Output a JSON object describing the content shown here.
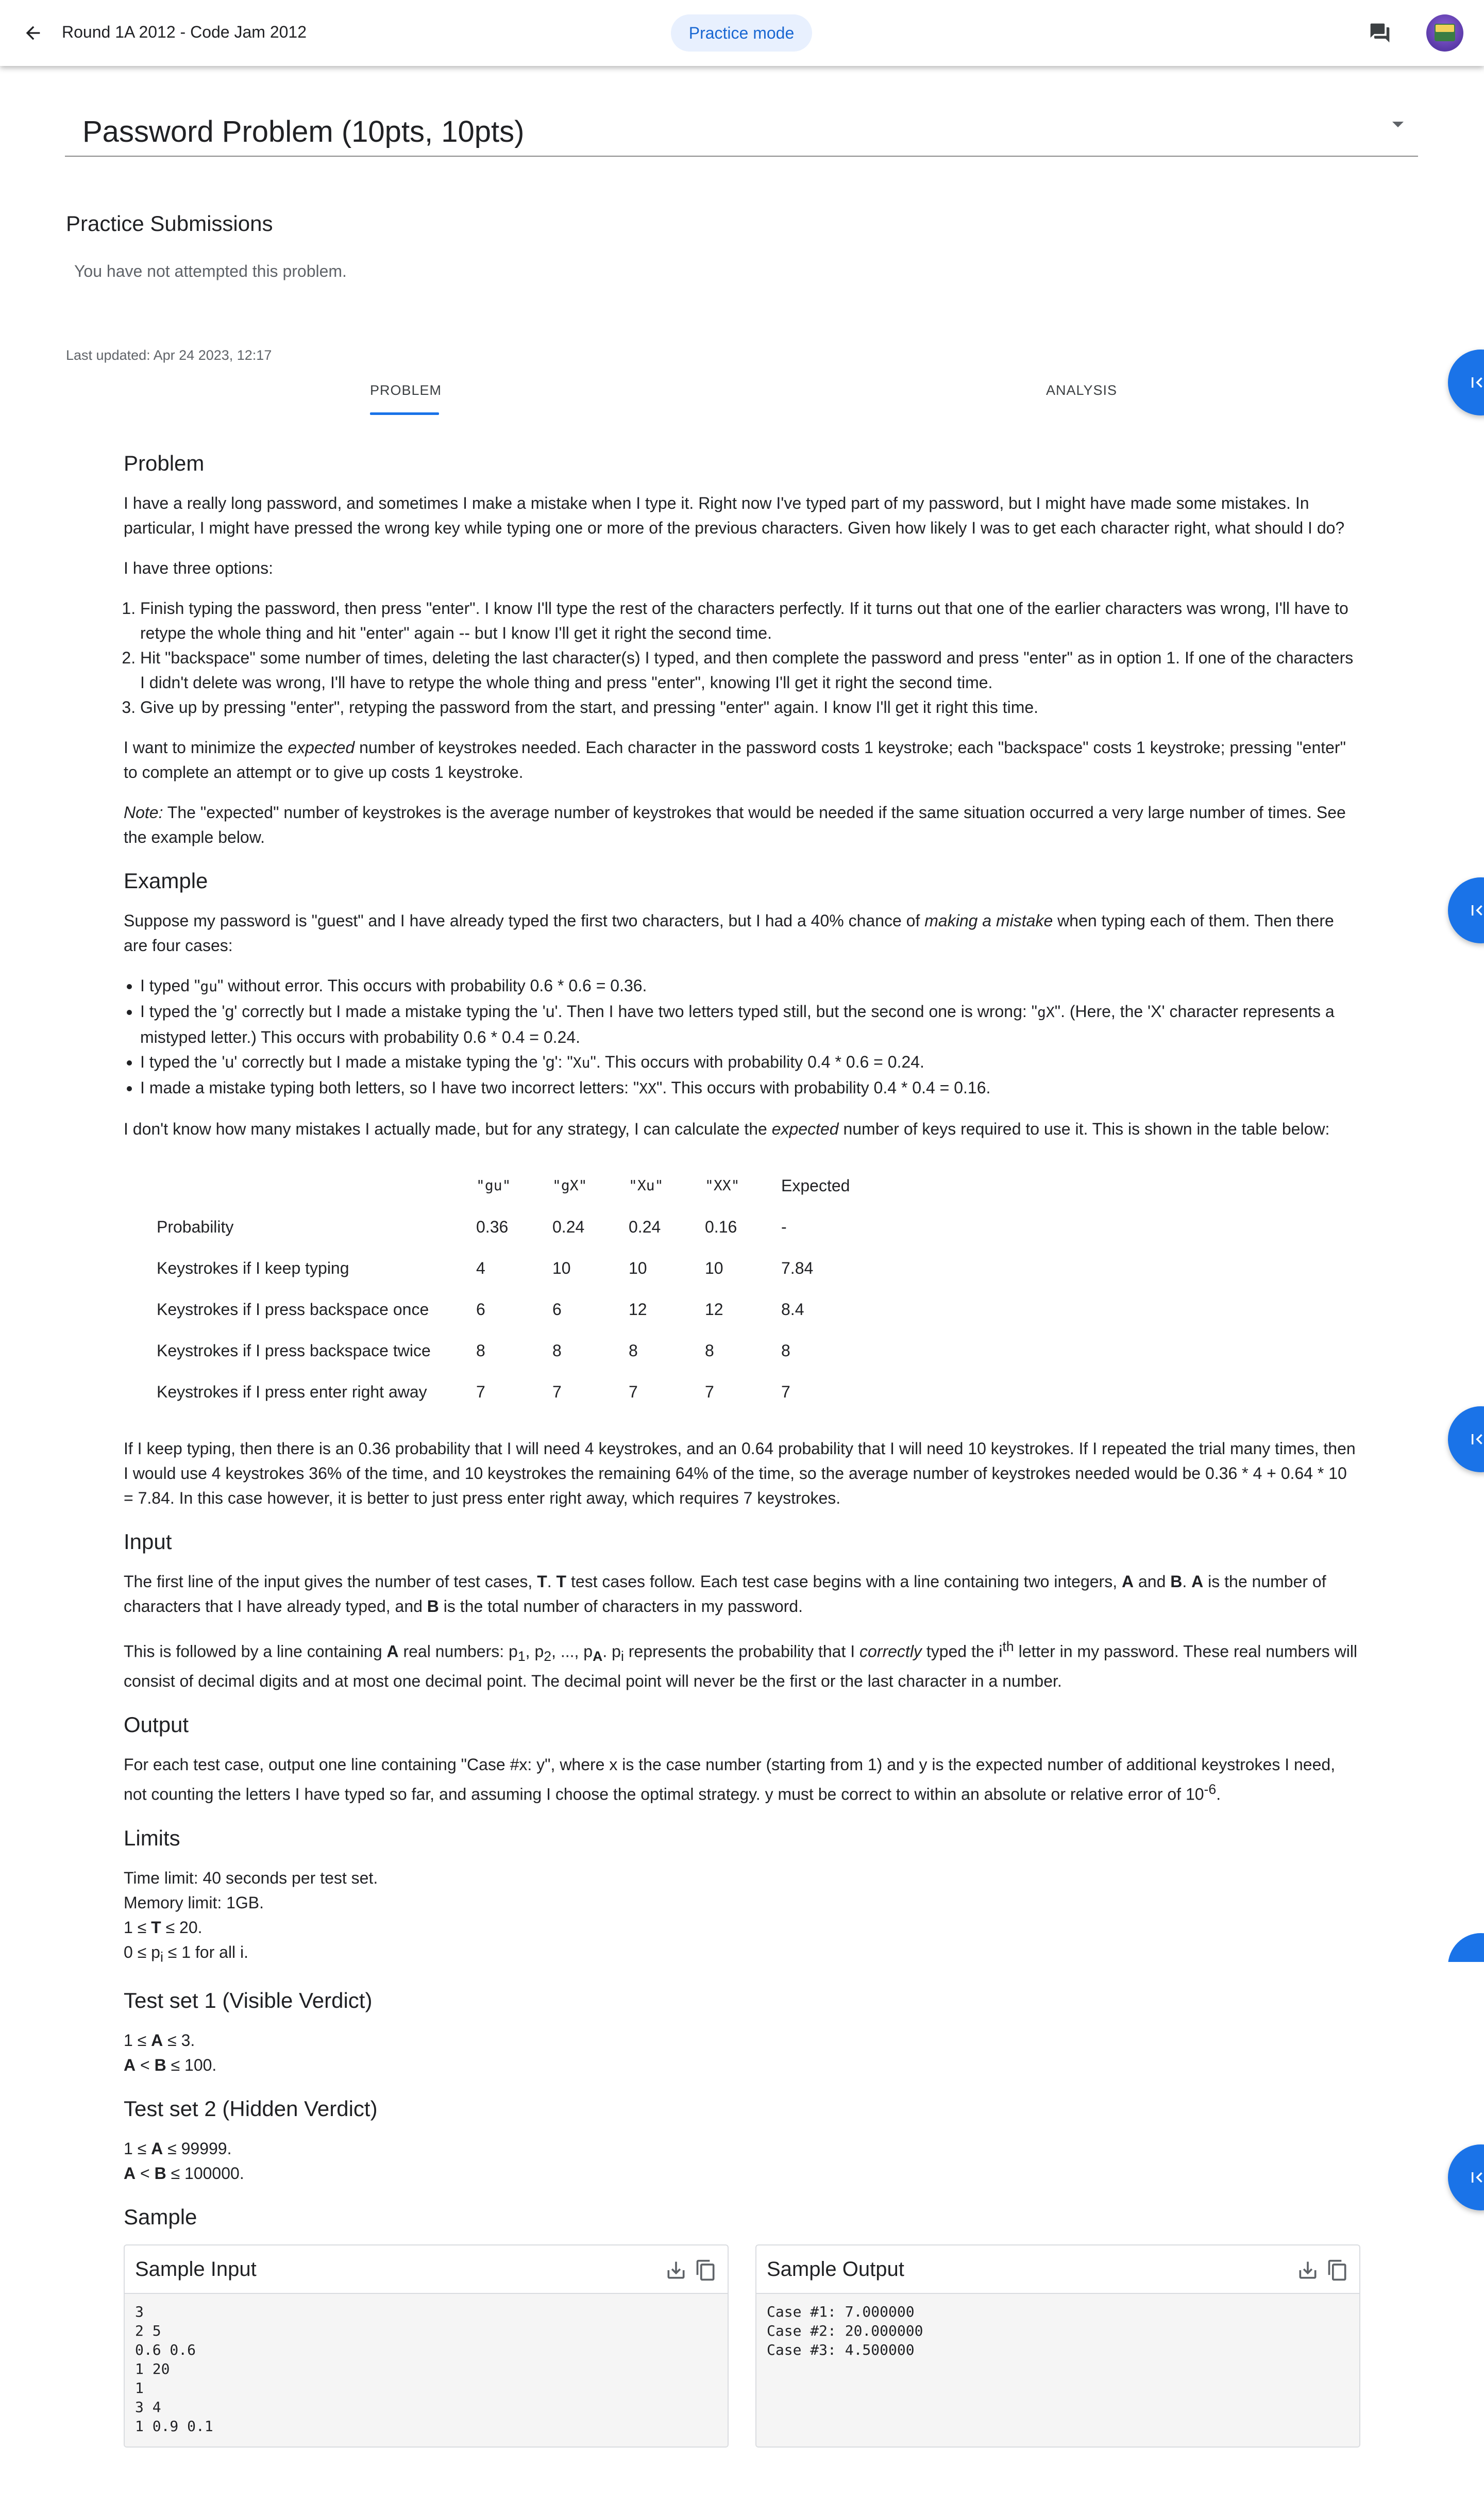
{
  "header": {
    "title": "Round 1A 2012 - Code Jam 2012",
    "practice_chip": "Practice mode"
  },
  "problem_selector": {
    "value": "Password Problem (10pts, 10pts)"
  },
  "practice_submissions": {
    "heading": "Practice Submissions",
    "empty_text": "You have not attempted this problem."
  },
  "last_updated": "Last updated: Apr 24 2023, 12:17",
  "tabs": [
    "PROBLEM",
    "ANALYSIS"
  ],
  "colors": {
    "accent": "#1a73e8",
    "chip_bg": "#e8f0fe",
    "chip_text": "#1967d2"
  },
  "problem": {
    "h_problem": "Problem",
    "p1": "I have a really long password, and sometimes I make a mistake when I type it. Right now I've typed part of my password, but I might have made some mistakes. In particular, I might have pressed the wrong key while typing one or more of the previous characters. Given how likely I was to get each character right, what should I do?",
    "p2": "I have three options:",
    "options": [
      "Finish typing the password, then press \"enter\". I know I'll type the rest of the characters perfectly. If it turns out that one of the earlier characters was wrong, I'll have to retype the whole thing and hit \"enter\" again -- but I know I'll get it right the second time.",
      "Hit \"backspace\" some number of times, deleting the last character(s) I typed, and then complete the password and press \"enter\" as in option 1. If one of the characters I didn't delete was wrong, I'll have to retype the whole thing and press \"enter\", knowing I'll get it right the second time.",
      "Give up by pressing \"enter\", retyping the password from the start, and pressing \"enter\" again. I know I'll get it right this time."
    ],
    "p3a": "I want to minimize the ",
    "p3em": "expected",
    "p3b": " number of keystrokes needed. Each character in the password costs 1 keystroke; each \"backspace\" costs 1 keystroke; pressing \"enter\" to complete an attempt or to give up costs 1 keystroke.",
    "note_em": "Note:",
    "note_text": " The \"expected\" number of keystrokes is the average number of keystrokes that would be needed if the same situation occurred a very large number of times. See the example below.",
    "h_example": "Example",
    "ex1a": "Suppose my password is \"guest\" and I have already typed the first two characters, but I had a 40% chance of ",
    "ex1em": "making a mistake",
    "ex1b": " when typing each of them. Then there are four cases:",
    "cases": [
      {
        "a": "I typed \"",
        "m": "gu",
        "b": "\" without error. This occurs with probability 0.6 * 0.6 = 0.36."
      },
      {
        "a": "I typed the 'g' correctly but I made a mistake typing the 'u'. Then I have two letters typed still, but the second one is wrong: \"",
        "m": "gX",
        "b": "\". (Here, the 'X' character represents a mistyped letter.) This occurs with probability 0.6 * 0.4 = 0.24."
      },
      {
        "a": "I typed the 'u' correctly but I made a mistake typing the 'g': \"",
        "m": "Xu",
        "b": "\". This occurs with probability 0.4 * 0.6 = 0.24."
      },
      {
        "a": "I made a mistake typing both letters, so I have two incorrect letters: \"",
        "m": "XX",
        "b": "\". This occurs with probability 0.4 * 0.4 = 0.16."
      }
    ],
    "ex2a": "I don't know how many mistakes I actually made, but for any strategy, I can calculate the ",
    "ex2em": "expected",
    "ex2b": " number of keys required to use it. This is shown in the table below:",
    "table": {
      "header": [
        "\"gu\"",
        "\"gX\"",
        "\"Xu\"",
        "\"XX\"",
        "Expected"
      ],
      "rows": [
        {
          "label": "Probability",
          "cells": [
            "0.36",
            "0.24",
            "0.24",
            "0.16",
            "-"
          ]
        },
        {
          "label": "Keystrokes if I keep typing",
          "cells": [
            "4",
            "10",
            "10",
            "10",
            "7.84"
          ]
        },
        {
          "label": "Keystrokes if I press backspace once",
          "cells": [
            "6",
            "6",
            "12",
            "12",
            "8.4"
          ]
        },
        {
          "label": "Keystrokes if I press backspace twice",
          "cells": [
            "8",
            "8",
            "8",
            "8",
            "8"
          ]
        },
        {
          "label": "Keystrokes if I press enter right away",
          "cells": [
            "7",
            "7",
            "7",
            "7",
            "7"
          ]
        }
      ]
    },
    "ex3": "If I keep typing, then there is an 0.36 probability that I will need 4 keystrokes, and an 0.64 probability that I will need 10 keystrokes. If I repeated the trial many times, then I would use 4 keystrokes 36% of the time, and 10 keystrokes the remaining 64% of the time, so the average number of keystrokes needed would be 0.36 * 4 + 0.64 * 10 = 7.84. In this case however, it is better to just press enter right away, which requires 7 keystrokes.",
    "h_input": "Input",
    "in1": [
      "The first line of the input gives the number of test cases, ",
      "T",
      ". ",
      "T",
      " test cases follow. Each test case begins with a line containing two integers, ",
      "A",
      " and ",
      "B",
      ". ",
      "A",
      " is the number of characters that I have already typed, and ",
      "B",
      " is the total number of characters in my password."
    ],
    "in2a": "This is followed by a line containing ",
    "in2b": "A",
    "in2c": " real numbers: p",
    "in2d": ". p",
    "in2e": " represents the probability that I ",
    "in2em": "correctly",
    "in2f": " typed the i",
    "in2sup": "th",
    "in2g": " letter in my password. These real numbers will consist of decimal digits and at most one decimal point. The decimal point will never be the first or the last character in a number.",
    "sub_1": "1",
    "sub_2": "2",
    "sub_A": "A",
    "sub_i": "i",
    "ellipsis": ", ..., p",
    "comma_p": ", p",
    "h_output": "Output",
    "out1": "For each test case, output one line containing \"Case #x: y\", where x is the case number (starting from 1) and y is the expected number of additional keystrokes I need, not counting the letters I have typed so far, and assuming I choose the optimal strategy. y must be correct to within an absolute or relative error of 10",
    "out_sup": "-6",
    "out_end": ".",
    "h_limits": "Limits",
    "lim_time": "Time limit: 40 seconds per test set.",
    "lim_mem": "Memory limit: 1GB.",
    "lim_t": [
      "1 ≤ ",
      "T",
      " ≤ 20."
    ],
    "lim_p": [
      "0 ≤ p",
      "i",
      " ≤ 1 for all i."
    ],
    "h_ts1": "Test set 1 (Visible Verdict)",
    "ts1": [
      [
        "1 ≤ ",
        "A",
        " ≤ 3."
      ],
      [
        "",
        "A",
        " < ",
        "B",
        " ≤ 100."
      ]
    ],
    "h_ts2": "Test set 2 (Hidden Verdict)",
    "ts2": [
      [
        "1 ≤ ",
        "A",
        " ≤ 99999."
      ],
      [
        "",
        "A",
        " < ",
        "B",
        " ≤ 100000."
      ]
    ],
    "h_sample": "Sample",
    "sample_input": {
      "title": "Sample Input",
      "lines": [
        "3",
        "2 5",
        "0.6 0.6",
        "1 20",
        "1",
        "3 4",
        "1 0.9 0.1"
      ]
    },
    "sample_output": {
      "title": "Sample Output",
      "lines": [
        "Case #1: 7.000000",
        "Case #2: 20.000000",
        "Case #3: 4.500000"
      ]
    }
  }
}
